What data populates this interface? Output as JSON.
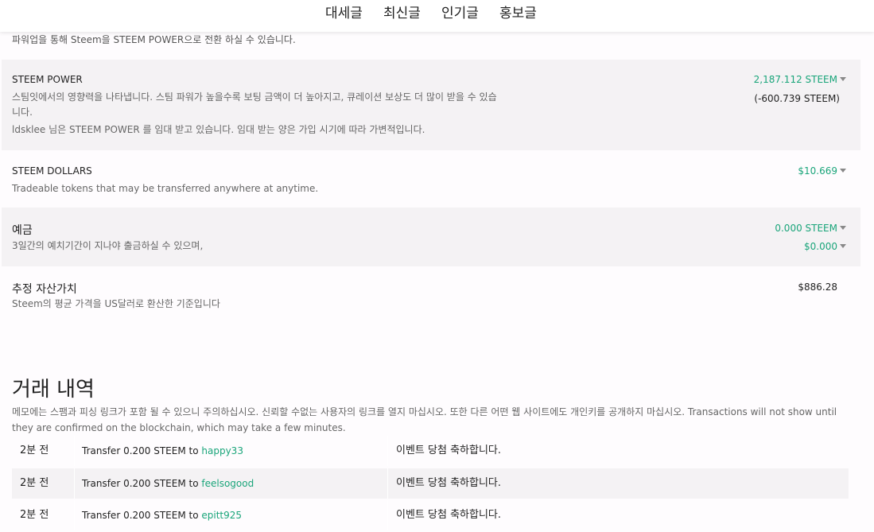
{
  "nav": [
    "대세글",
    "최신글",
    "인기글",
    "홍보글"
  ],
  "intro": "파워업을 통해 Steem을 STEEM POWER으로 전환 하실 수 있습니다.",
  "steem_power": {
    "title": "STEEM POWER",
    "desc_line1": "스팀잇에서의 영향력을 나타냅니다. 스팀 파워가 높을수록 보팅 금액이 더 높아지고, 큐레이션 보상도 더 많이 받을 수 있습",
    "desc_line2": "니다.",
    "desc_line3": "ldsklee 님은 STEEM POWER 를 임대 받고 있습니다. 임대 받는 양은 가입 시기에 따라 가변적입니다.",
    "amount": "2,187.112 STEEM",
    "delegated": "(-600.739 STEEM)"
  },
  "steem_dollars": {
    "title": "STEEM DOLLARS",
    "desc": "Tradeable tokens that may be transferred anywhere at anytime.",
    "amount": "$10.669"
  },
  "savings": {
    "title": "예금",
    "desc": "3일간의 예치기간이 지나야 출금하실 수 있으며,",
    "amount_steem": "0.000 STEEM",
    "amount_sbd": "$0.000"
  },
  "estimated": {
    "title": "추정 자산가치",
    "desc": "Steem의 평균 가격을 US달러로 환산한 기준입니다",
    "amount": "$886.28"
  },
  "history": {
    "title": "거래 내역",
    "note": "메모에는 스팸과 피싱 링크가 포함 될 수 있으니 주의하십시오. 신뢰할 수없는 사용자의 링크를 열지 마십시오. 또한 다른 어떤 웹 사이트에도 개인키를 공개하지 마십시오. Transactions will not show until they are confirmed on the blockchain, which may take a few minutes.",
    "rows": [
      {
        "time": "2분 전",
        "text": "Transfer 0.200 STEEM to",
        "user": "happy33",
        "memo": "이벤트 당첨 축하합니다."
      },
      {
        "time": "2분 전",
        "text": "Transfer 0.200 STEEM to",
        "user": "feelsogood",
        "memo": "이벤트 당첨 축하합니다."
      },
      {
        "time": "2분 전",
        "text": "Transfer 0.200 STEEM to",
        "user": "epitt925",
        "memo": "이벤트 당첨 축하합니다."
      }
    ]
  },
  "colors": {
    "accent": "#1aa57a",
    "shaded_row": "#f4f2f4"
  },
  "icons": {
    "caret": "caret-down-icon"
  }
}
